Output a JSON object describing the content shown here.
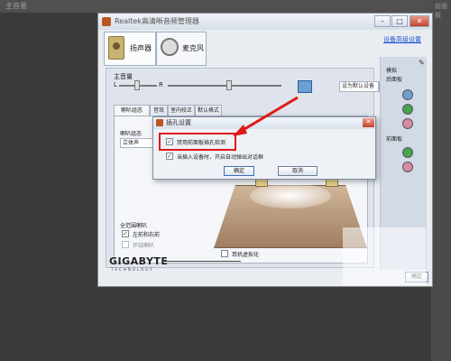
{
  "background": {
    "top_title": "主音量",
    "right_text": "前面板"
  },
  "window": {
    "title": "Realtek高清晰音频管理器",
    "controls": {
      "minimize": "–",
      "maximize": "□",
      "close": "✕"
    },
    "advanced_link": "设备高级设置",
    "device_tabs": [
      {
        "label": "扬声器"
      },
      {
        "label": "麦克风"
      }
    ],
    "main_volume": {
      "label": "主音量",
      "left": "L",
      "right": "R",
      "level": 0.55,
      "balance": 0.5
    },
    "set_default": "设为默认设备",
    "sub_tabs": [
      "喇叭组态",
      "音效",
      "室内校正",
      "默认格式"
    ],
    "config_label": "喇叭组态",
    "config_value": "立体声",
    "full_range": "全范围喇叭",
    "lr_label": "左前和右前",
    "surround_label": "环绕喇叭",
    "virtual_label": "耳机虚拟化",
    "side_labels": {
      "analog": "模拟",
      "back": "后面板",
      "front": "前面板"
    },
    "logo": "GIGABYTE",
    "logo_sub": "TECHNOLOGY",
    "ok_button": "确定"
  },
  "dialog": {
    "title": "插孔设置",
    "close": "✕",
    "option1": "禁用前面板插孔检测",
    "option2": "当插入设备时，开启自动弹出对话框",
    "ok": "确定",
    "cancel": "取消"
  },
  "colors": {
    "highlight": "#e01818",
    "jack_blue": "#6f9fc8",
    "jack_green": "#49a24c",
    "jack_pink": "#d88aa0"
  }
}
